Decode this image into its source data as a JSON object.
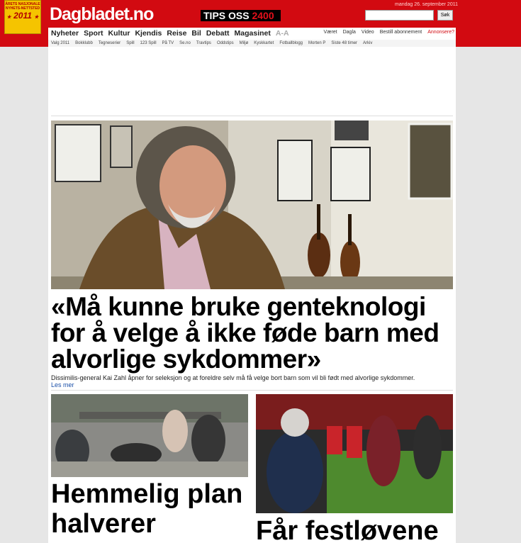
{
  "header": {
    "badge_text": "ÅRETS NASJONALE NYHETS-NETTSTED",
    "badge_year": "2011",
    "badge_star": "★",
    "logo": "Dagbladet.no",
    "tips_label": "TIPS OSS",
    "tips_number": "2400",
    "date": "mandag 26. september 2011",
    "search_button": "Søk",
    "search_value": ""
  },
  "nav": {
    "main_items": [
      "Nyheter",
      "Sport",
      "Kultur",
      "Kjendis",
      "Reise",
      "Bil",
      "Debatt",
      "Magasinet"
    ],
    "text_size": "A-A",
    "right_items": [
      "Været",
      "Dagla",
      "Video",
      "Bestill abonnement"
    ],
    "right_highlight": "Annonsere?"
  },
  "subnav": {
    "items": [
      "Valg 2011",
      "Bokklubb",
      "Tegneserier",
      "Spill",
      "123 Spill",
      "På TV",
      "Se.no",
      "Travtips",
      "Oddstips",
      "Miljø",
      "Kyskkartet",
      "Fotballblogg",
      "Morten P",
      "Siste 48 timer",
      "Arkiv"
    ]
  },
  "main_story": {
    "headline": "«Må kunne bruke genteknologi for å velge å ikke føde barn med alvorlige sykdommer»",
    "lead": "Dissimilis-general Kai Zahl åpner for seleksjon og at foreldre selv må få velge bort barn som vil bli født med alvorlige sykdommer.",
    "read_more": "Les mer"
  },
  "story2": {
    "headline": "Hemmelig plan halverer"
  },
  "story3": {
    "headline": "Får festløvene"
  },
  "colors": {
    "brand_red": "#d20a11",
    "badge_yellow": "#f5c400",
    "link_blue": "#1a4fa8"
  }
}
